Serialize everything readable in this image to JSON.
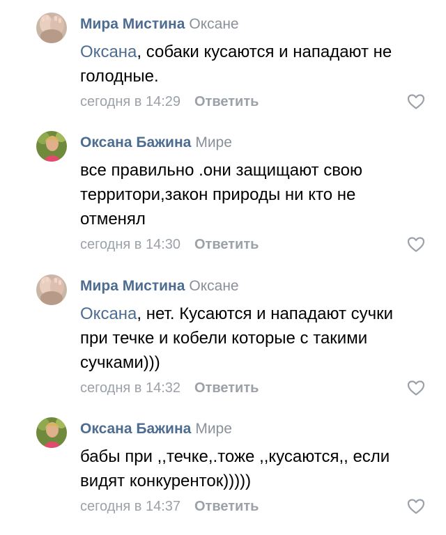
{
  "comments": [
    {
      "author": "Мира Мистина",
      "reply_to": "Оксане",
      "mention": "Оксана",
      "text": ", собаки кусаются и нападают не голодные.",
      "time": "сегодня в 14:29",
      "reply_label": "Ответить"
    },
    {
      "author": "Оксана Бажина",
      "reply_to": "Мире",
      "mention": "",
      "text": "все правильно .они защищают свою территори,закон природы ни кто не отменял",
      "time": "сегодня в 14:30",
      "reply_label": "Ответить"
    },
    {
      "author": "Мира Мистина",
      "reply_to": "Оксане",
      "mention": "Оксана",
      "text": ", нет. Кусаются и нападают сучки при течке и кобели которые с такими сучками)))",
      "time": "сегодня в 14:32",
      "reply_label": "Ответить"
    },
    {
      "author": "Оксана Бажина",
      "reply_to": "Мире",
      "mention": "",
      "text": "бабы при ,,течке,.тоже ,,кусаются,, если видят конкуренток)))))",
      "time": "сегодня в 14:37",
      "reply_label": "Ответить"
    }
  ],
  "icons": {
    "like": "heart-outline-icon",
    "avatar_mira": "avatar-hands-icon",
    "avatar_oksana": "avatar-woman-icon"
  },
  "colors": {
    "link": "#4d6c91",
    "muted": "#9ba1a8",
    "text": "#000000",
    "background": "#ffffff"
  }
}
